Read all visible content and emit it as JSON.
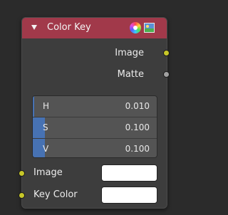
{
  "node": {
    "title": "Color Key",
    "icons": [
      "color-wheel-icon",
      "image-preview-icon"
    ],
    "header_color": "#a1394a",
    "outputs": [
      {
        "label": "Image",
        "socket_color": "#c7c729"
      },
      {
        "label": "Matte",
        "socket_color": "#a1a1a1"
      }
    ],
    "hsv": [
      {
        "label": "H",
        "value": "0.010",
        "fill": 0.01
      },
      {
        "label": "S",
        "value": "0.100",
        "fill": 0.1
      },
      {
        "label": "V",
        "value": "0.100",
        "fill": 0.1
      }
    ],
    "inputs": [
      {
        "label": "Image",
        "socket_color": "#c7c729",
        "swatch_color": "#ffffff"
      },
      {
        "label": "Key Color",
        "socket_color": "#c7c729",
        "swatch_color": "#ffffff"
      }
    ]
  }
}
